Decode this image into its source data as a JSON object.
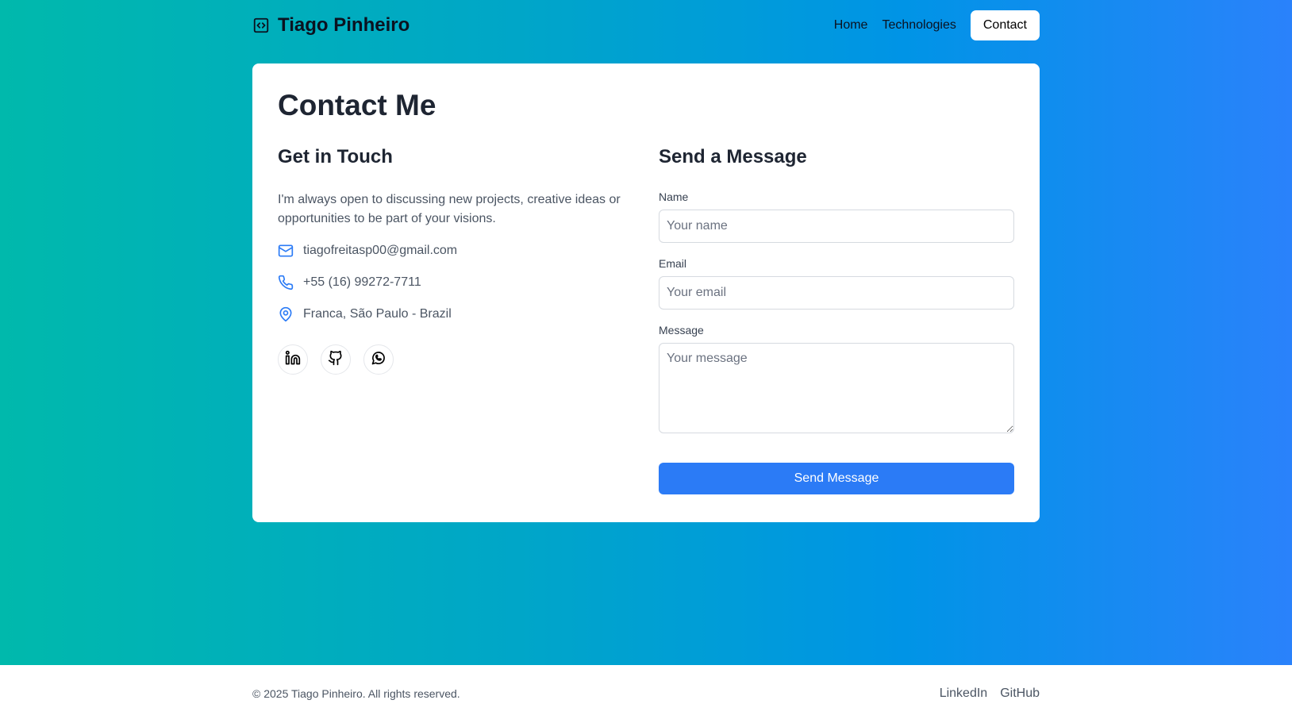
{
  "header": {
    "brand_icon": "code-icon",
    "brand_name": "Tiago Pinheiro",
    "nav": [
      {
        "label": "Home"
      },
      {
        "label": "Technologies"
      },
      {
        "label": "Contact",
        "active": true
      }
    ]
  },
  "main": {
    "title": "Contact Me",
    "get_in_touch": {
      "title": "Get in Touch",
      "intro": "I'm always open to discussing new projects, creative ideas or opportunities to be part of your visions.",
      "items": [
        {
          "icon": "mail-icon",
          "text": "tiagofreitasp00@gmail.com"
        },
        {
          "icon": "phone-icon",
          "text": "+55 (16) 99272-7711"
        },
        {
          "icon": "map-pin-icon",
          "text": "Franca, São Paulo - Brazil"
        }
      ],
      "socials": [
        {
          "icon": "linkedin-icon"
        },
        {
          "icon": "github-icon"
        },
        {
          "icon": "whatsapp-icon"
        }
      ]
    },
    "form": {
      "title": "Send a Message",
      "name_label": "Name",
      "name_placeholder": "Your name",
      "email_label": "Email",
      "email_placeholder": "Your email",
      "message_label": "Message",
      "message_placeholder": "Your message",
      "submit_label": "Send Message"
    }
  },
  "footer": {
    "copyright": "© 2025 Tiago Pinheiro. All rights reserved.",
    "links": [
      {
        "label": "LinkedIn"
      },
      {
        "label": "GitHub"
      }
    ]
  },
  "colors": {
    "accent": "#2b7bf6",
    "gradient_start": "#00b9ac",
    "gradient_end": "#2a82fb",
    "icon_blue": "#2b7bf6"
  }
}
